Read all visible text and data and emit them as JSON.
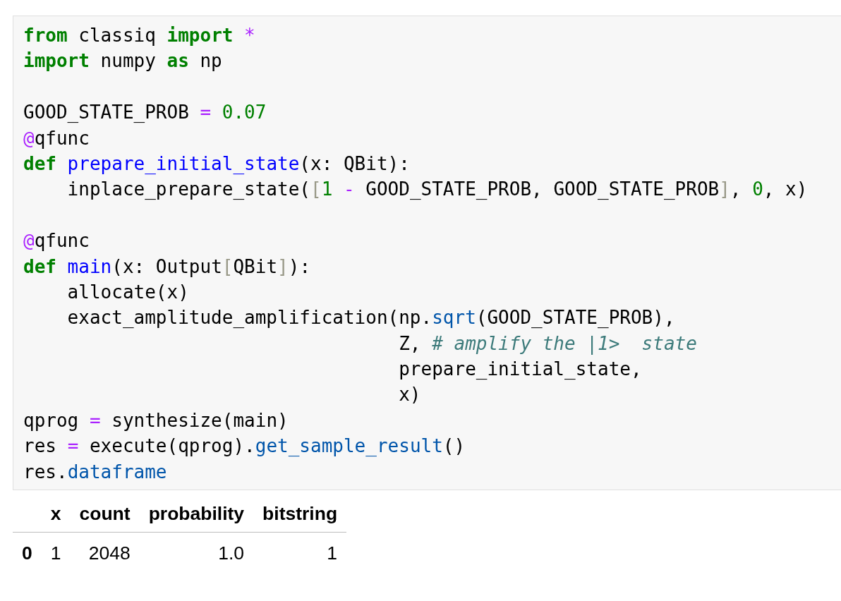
{
  "code_cell": {
    "blocks": [
      [
        [
          {
            "text": "from",
            "kind": "kw"
          },
          {
            "text": " classiq ",
            "kind": "plain"
          },
          {
            "text": "import",
            "kind": "kw"
          },
          {
            "text": " *",
            "kind": "op"
          }
        ],
        [
          {
            "text": "import",
            "kind": "kw"
          },
          {
            "text": " numpy ",
            "kind": "plain"
          },
          {
            "text": "as",
            "kind": "kw"
          },
          {
            "text": " np",
            "kind": "plain"
          }
        ]
      ],
      [
        [
          {
            "text": "GOOD_STATE_PROB ",
            "kind": "plain"
          },
          {
            "text": "=",
            "kind": "op"
          },
          {
            "text": " 0.07",
            "kind": "num"
          }
        ],
        [
          {
            "text": "@",
            "kind": "op"
          },
          {
            "text": "qfunc",
            "kind": "plain"
          }
        ],
        [
          {
            "text": "def",
            "kind": "kw"
          },
          {
            "text": " prepare_initial_state",
            "kind": "fn"
          },
          {
            "text": "(x: QBit):",
            "kind": "plain"
          }
        ],
        [
          {
            "text": "    inplace_prepare_state(",
            "kind": "plain"
          },
          {
            "text": "[",
            "kind": "bracket"
          },
          {
            "text": "1 ",
            "kind": "num"
          },
          {
            "text": "-",
            "kind": "op"
          },
          {
            "text": " GOOD_STATE_PROB, GOOD_STATE_PROB",
            "kind": "plain"
          },
          {
            "text": "]",
            "kind": "bracket"
          },
          {
            "text": ", ",
            "kind": "plain"
          },
          {
            "text": "0",
            "kind": "num"
          },
          {
            "text": ", x)",
            "kind": "plain"
          }
        ]
      ],
      [
        [
          {
            "text": "@",
            "kind": "op"
          },
          {
            "text": "qfunc",
            "kind": "plain"
          }
        ],
        [
          {
            "text": "def",
            "kind": "kw"
          },
          {
            "text": " main",
            "kind": "fn"
          },
          {
            "text": "(x: Output",
            "kind": "plain"
          },
          {
            "text": "[",
            "kind": "bracket"
          },
          {
            "text": "QBit",
            "kind": "plain"
          },
          {
            "text": "]",
            "kind": "bracket"
          },
          {
            "text": "):",
            "kind": "plain"
          }
        ],
        [
          {
            "text": "    allocate(x)",
            "kind": "plain"
          }
        ],
        [
          {
            "text": "    exact_amplitude_amplification(np.",
            "kind": "plain"
          },
          {
            "text": "sqrt",
            "kind": "attr"
          },
          {
            "text": "(GOOD_STATE_PROB),",
            "kind": "plain"
          }
        ],
        [
          {
            "text": "                                  Z, ",
            "kind": "plain"
          },
          {
            "text": "# amplify the |1>  state",
            "kind": "comment"
          }
        ],
        [
          {
            "text": "                                  prepare_initial_state,",
            "kind": "plain"
          }
        ],
        [
          {
            "text": "                                  x)",
            "kind": "plain"
          }
        ],
        [
          {
            "text": "qprog ",
            "kind": "plain"
          },
          {
            "text": "=",
            "kind": "op"
          },
          {
            "text": " synthesize(main)",
            "kind": "plain"
          }
        ],
        [
          {
            "text": "res ",
            "kind": "plain"
          },
          {
            "text": "=",
            "kind": "op"
          },
          {
            "text": " execute(qprog).",
            "kind": "plain"
          },
          {
            "text": "get_sample_result",
            "kind": "attr"
          },
          {
            "text": "()",
            "kind": "plain"
          }
        ],
        [
          {
            "text": "res.",
            "kind": "plain"
          },
          {
            "text": "dataframe",
            "kind": "attr"
          }
        ]
      ]
    ]
  },
  "output_table": {
    "columns": [
      "x",
      "count",
      "probability",
      "bitstring"
    ],
    "rows": [
      {
        "index": "0",
        "cells": [
          "1",
          "2048",
          "1.0",
          "1"
        ]
      }
    ]
  }
}
